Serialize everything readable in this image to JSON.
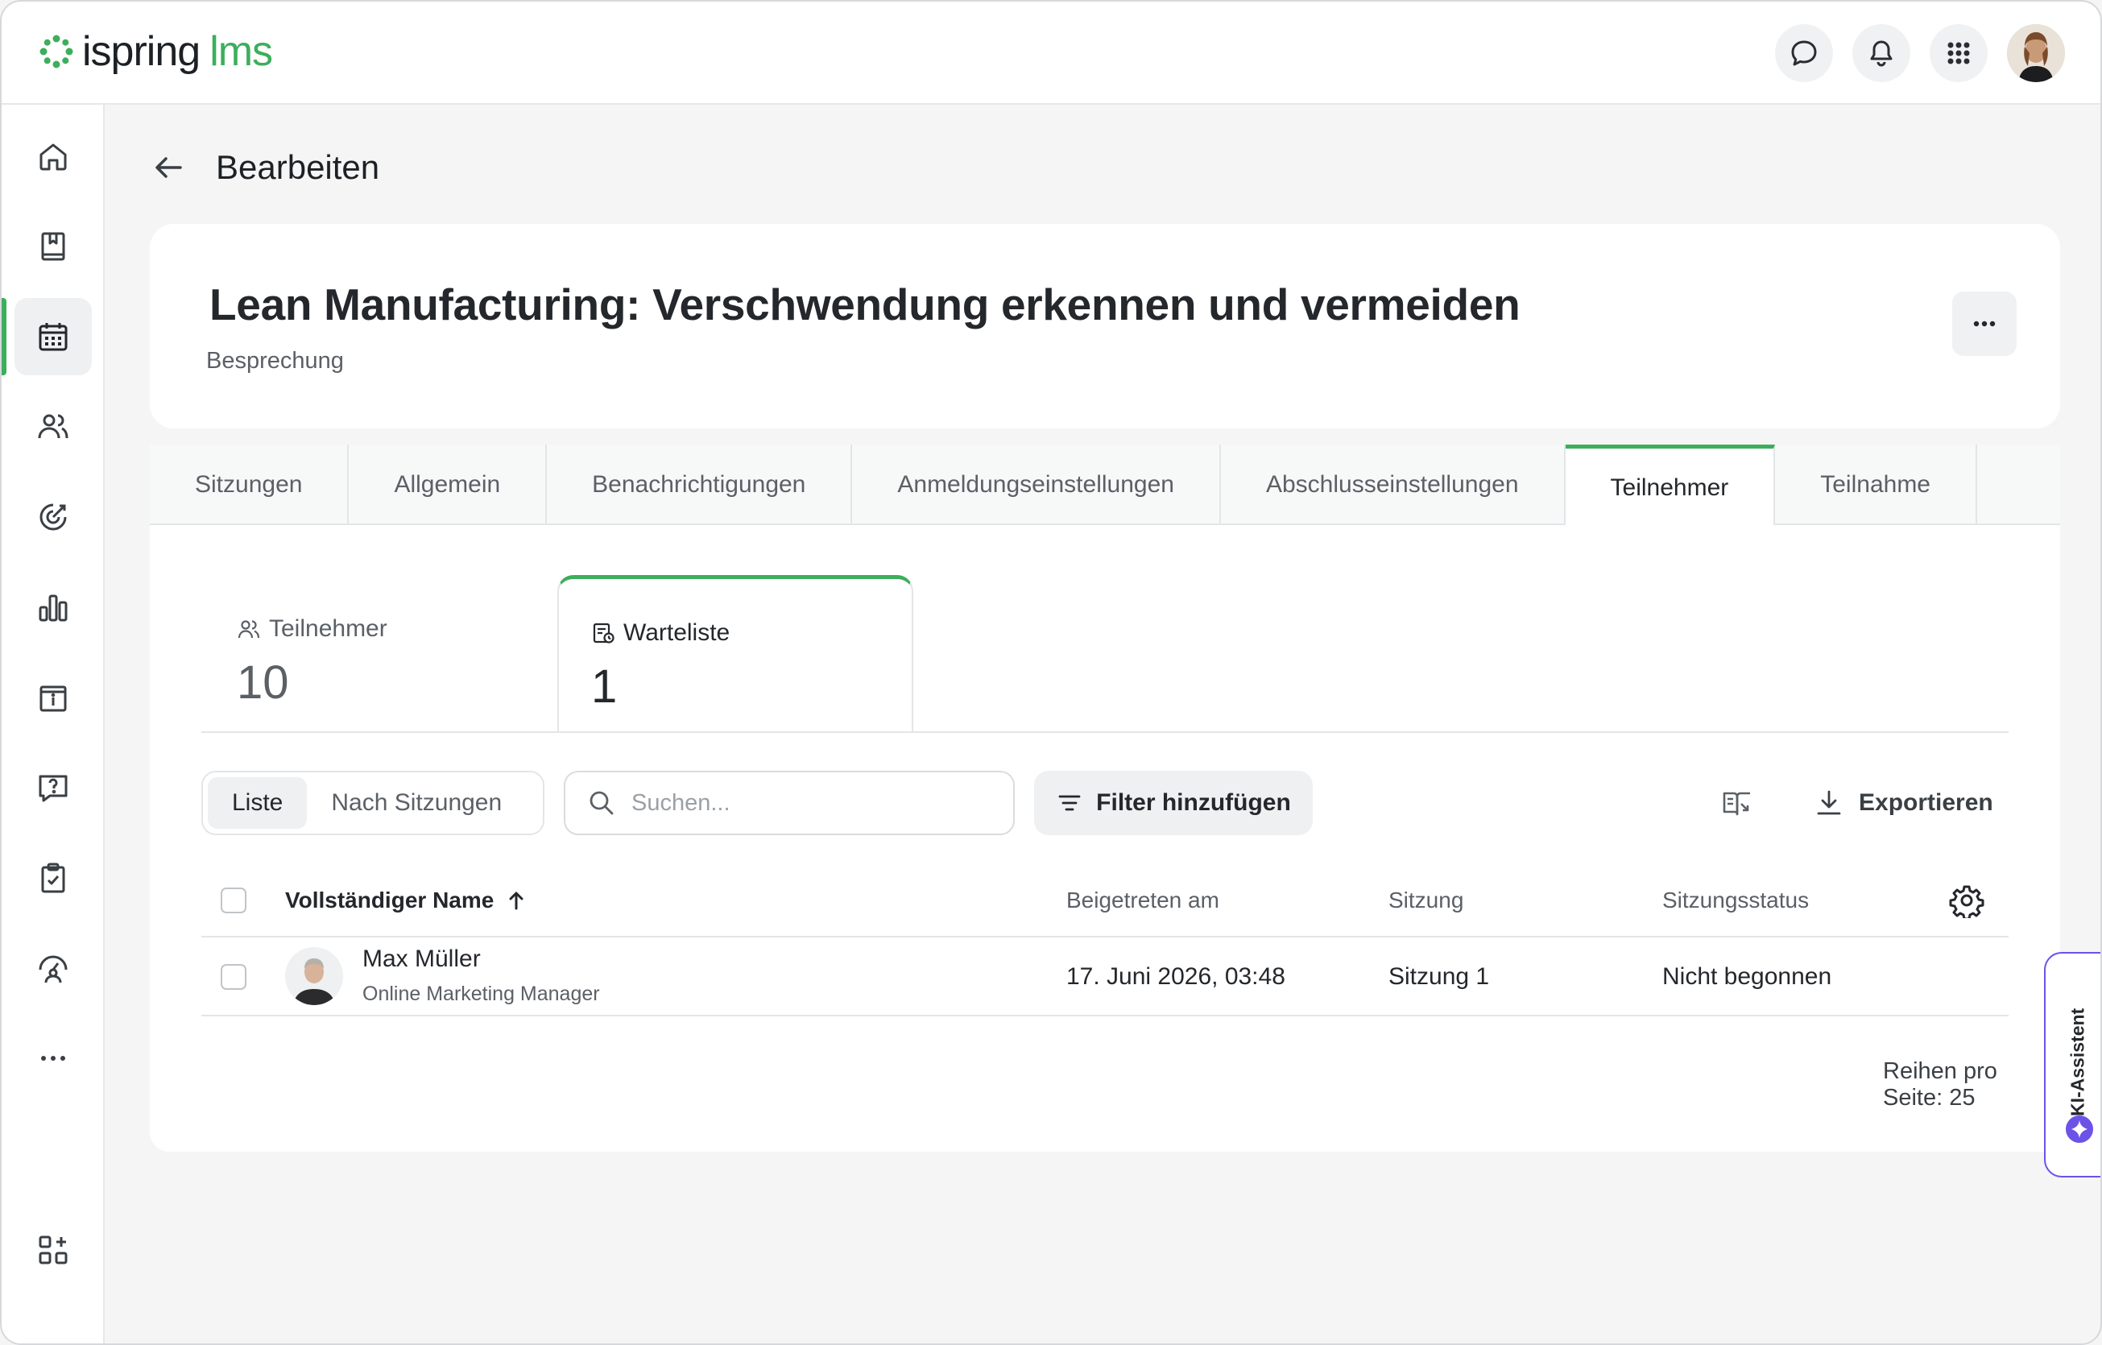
{
  "header": {
    "logo_text": "ispring",
    "logo_suffix": "lms",
    "icons": [
      "chat-icon",
      "bell-icon",
      "apps-grid-icon"
    ]
  },
  "sidebar": {
    "items": [
      {
        "name": "home",
        "icon": "home-icon"
      },
      {
        "name": "courses",
        "icon": "book-icon"
      },
      {
        "name": "calendar",
        "icon": "calendar-icon",
        "active": true
      },
      {
        "name": "users",
        "icon": "users-icon"
      },
      {
        "name": "goals",
        "icon": "target-icon"
      },
      {
        "name": "reports",
        "icon": "bar-chart-icon"
      },
      {
        "name": "info",
        "icon": "info-board-icon"
      },
      {
        "name": "questions",
        "icon": "question-chat-icon"
      },
      {
        "name": "tasks",
        "icon": "clipboard-check-icon"
      },
      {
        "name": "performance",
        "icon": "gauge-person-icon"
      },
      {
        "name": "more",
        "icon": "ellipsis-icon"
      },
      {
        "name": "add-widgets",
        "icon": "add-widget-icon"
      }
    ],
    "accent": "#3dae5c"
  },
  "page": {
    "title": "Bearbeiten"
  },
  "event": {
    "title": "Lean Manufacturing: Verschwendung erkennen und vermeiden",
    "type": "Besprechung",
    "more_label": "..."
  },
  "tabs": [
    "Sitzungen",
    "Allgemein",
    "Benachrichtigungen",
    "Anmeldungseinstellungen",
    "Abschlusseinstellungen",
    "Teilnehmer",
    "Teilnahme"
  ],
  "active_tab": "Teilnehmer",
  "stats": {
    "participants": {
      "label": "Teilnehmer",
      "count": "10"
    },
    "waitlist": {
      "label": "Warteliste",
      "count": "1",
      "active": true
    }
  },
  "toolbar": {
    "view_list": "Liste",
    "view_sessions": "Nach Sitzungen",
    "search_placeholder": "Suchen...",
    "filter_label": "Filter hinzufügen",
    "export_label": "Exportieren"
  },
  "table": {
    "columns": {
      "name": "Vollständiger Name",
      "joined": "Beigetreten am",
      "session": "Sitzung",
      "status": "Sitzungsstatus"
    },
    "rows": [
      {
        "name": "Max Müller",
        "role": "Online Marketing Manager",
        "joined": "17. Juni 2026, 03:48",
        "session": "Sitzung 1",
        "status": "Nicht begonnen"
      }
    ]
  },
  "pagination": {
    "rows_per_page": "Reihen pro Seite: 25"
  },
  "ai_assistant": {
    "label": "KI-Assistent",
    "color": "#6d52e8"
  }
}
